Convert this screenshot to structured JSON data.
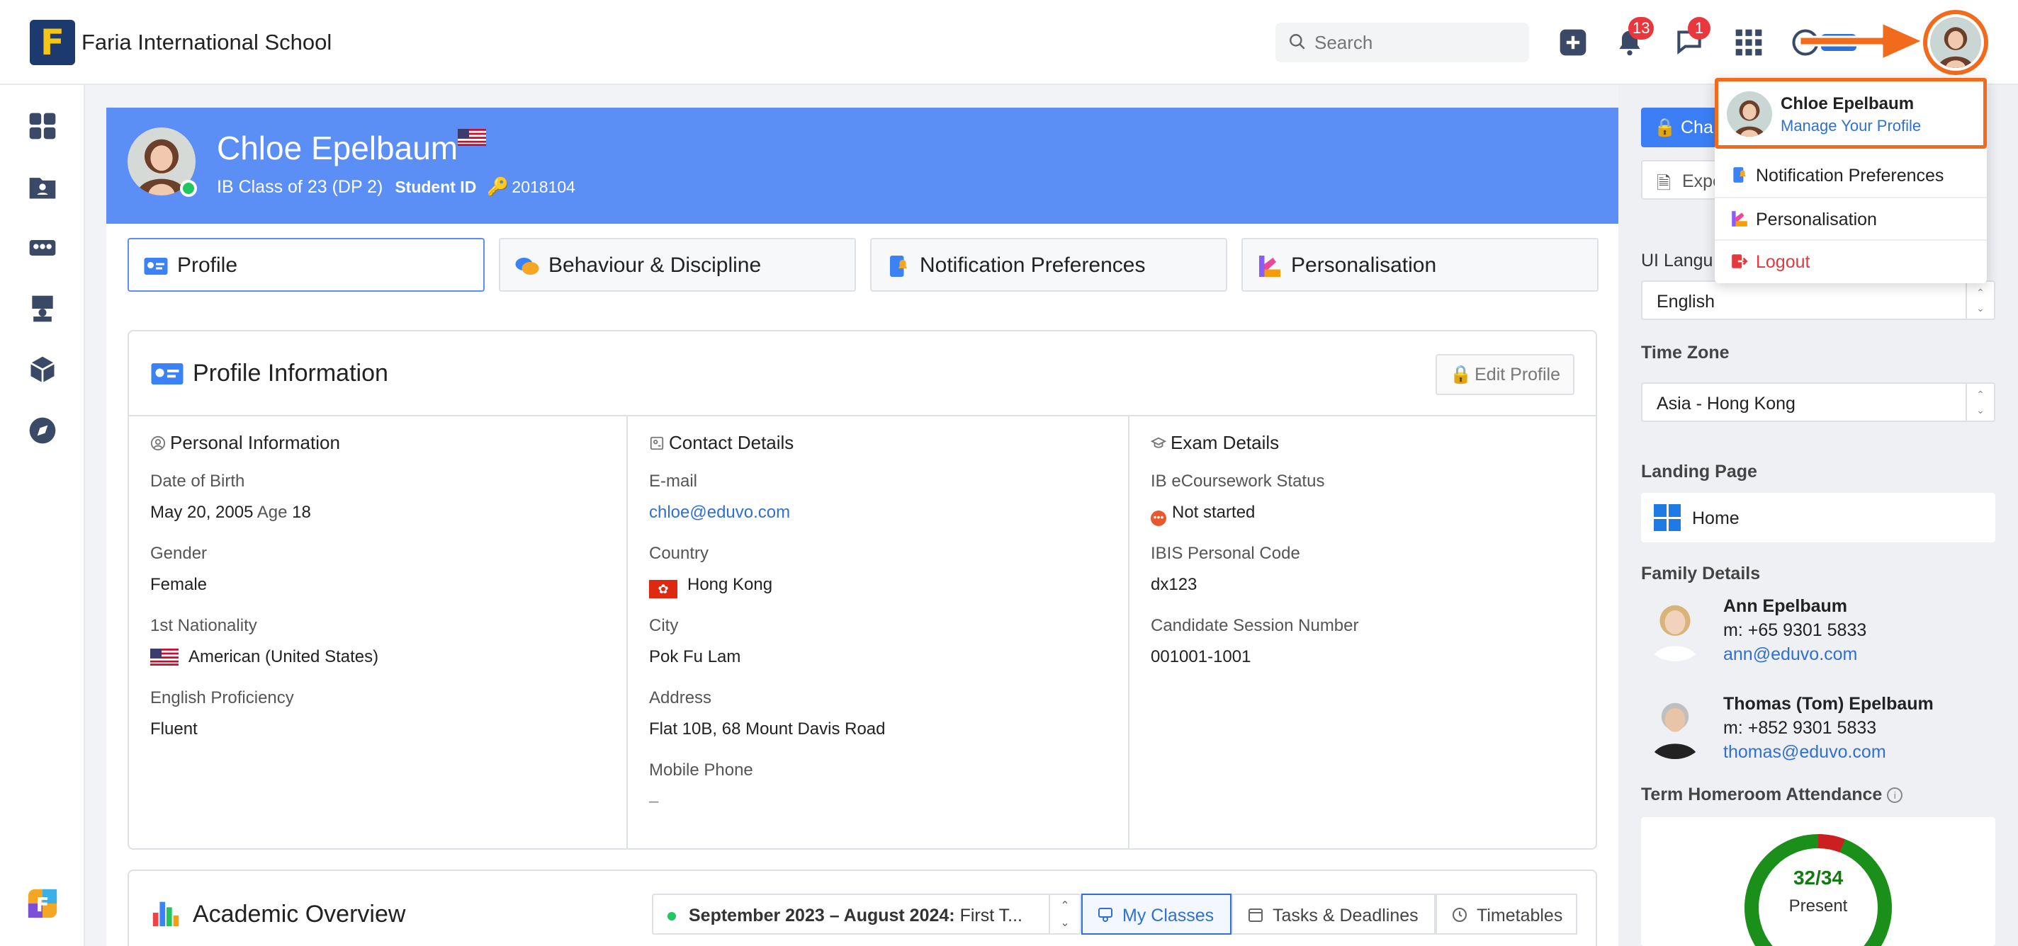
{
  "app": {
    "school_name": "Faria International School",
    "logo_letter": "F"
  },
  "search": {
    "placeholder": "Search"
  },
  "topbar": {
    "notifications_count": "13",
    "messages_count": "1"
  },
  "student": {
    "name": "Chloe Epelbaum",
    "class": "IB Class of 23 (DP 2)",
    "id_label": "Student ID",
    "id_value": "2018104"
  },
  "tabs": [
    {
      "label": "Profile",
      "icon": "id-card-icon"
    },
    {
      "label": "Behaviour & Discipline",
      "icon": "chat-bubbles-icon"
    },
    {
      "label": "Notification Preferences",
      "icon": "phone-bell-icon"
    },
    {
      "label": "Personalisation",
      "icon": "palette-icon"
    }
  ],
  "profile": {
    "title": "Profile Information",
    "edit_button": "Edit Profile",
    "personal": {
      "title": "Personal Information",
      "dob_label": "Date of Birth",
      "dob_value": "May 20, 2005",
      "age_label": "Age",
      "age_value": "18",
      "gender_label": "Gender",
      "gender_value": "Female",
      "nationality_label": "1st Nationality",
      "nationality_value": "American (United States)",
      "english_label": "English Proficiency",
      "english_value": "Fluent"
    },
    "contact": {
      "title": "Contact Details",
      "email_label": "E-mail",
      "email_value": "chloe@eduvo.com",
      "country_label": "Country",
      "country_value": "Hong Kong",
      "city_label": "City",
      "city_value": "Pok Fu Lam",
      "address_label": "Address",
      "address_value": "Flat 10B, 68 Mount Davis Road",
      "mobile_label": "Mobile Phone",
      "mobile_value": "–"
    },
    "exam": {
      "title": "Exam Details",
      "ecoursework_label": "IB eCoursework Status",
      "ecoursework_value": "Not started",
      "ibis_label": "IBIS Personal Code",
      "ibis_value": "dx123",
      "candidate_label": "Candidate Session Number",
      "candidate_value": "001001-1001"
    }
  },
  "academic": {
    "title": "Academic Overview",
    "term_bold": "September 2023 – August 2024:",
    "term_rest": " First T...",
    "buttons": [
      "My Classes",
      "Tasks & Deadlines",
      "Timetables"
    ]
  },
  "right": {
    "change_button": "Cha",
    "export_button": "Expo",
    "ui_language_label": "UI Langu",
    "ui_language_value": "English",
    "timezone_label": "Time Zone",
    "timezone_value": "Asia - Hong Kong",
    "landing_label": "Landing Page",
    "landing_value": "Home",
    "family_label": "Family Details",
    "family": [
      {
        "name": "Ann Epelbaum",
        "mobile": "m: +65 9301 5833",
        "email": "ann@eduvo.com"
      },
      {
        "name": "Thomas (Tom) Epelbaum",
        "mobile": "m: +852 9301 5833",
        "email": "thomas@eduvo.com"
      }
    ],
    "attendance_label": "Term Homeroom Attendance",
    "attendance_value": "32/34",
    "attendance_status": "Present",
    "attendance_fraction": 0.941
  },
  "dropdown": {
    "name": "Chloe Epelbaum",
    "manage": "Manage Your Profile",
    "items": [
      "Notification Preferences",
      "Personalisation",
      "Logout"
    ]
  },
  "colors": {
    "banner": "#5b8ff5",
    "accent": "#2f6fd6",
    "highlight": "#f26b1d",
    "attendance_present": "#1a8f1a",
    "attendance_absent": "#cc1f1f"
  }
}
